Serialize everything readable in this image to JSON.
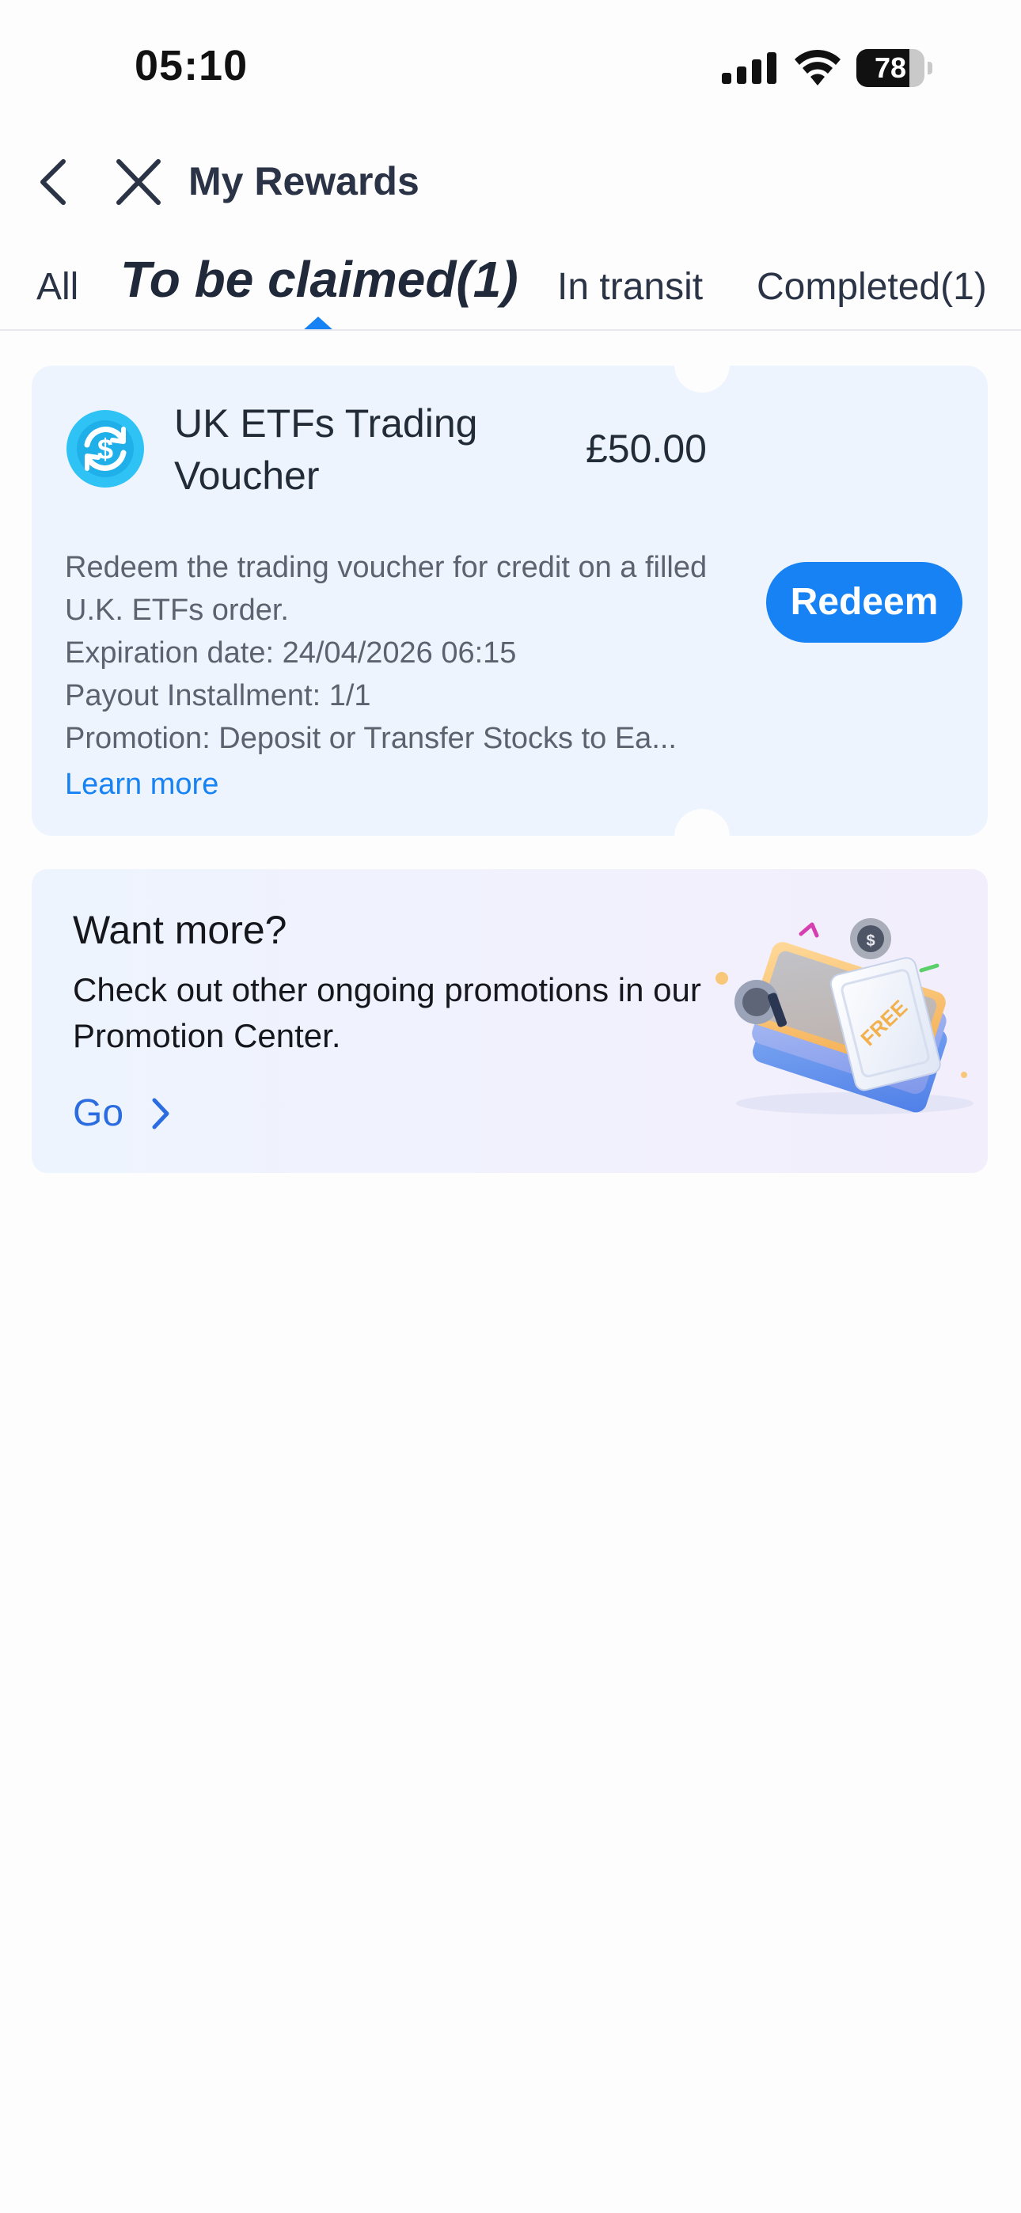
{
  "status_bar": {
    "time": "05:10",
    "battery": "78",
    "battery_level": 0.78
  },
  "header": {
    "title": "My Rewards"
  },
  "tabs": [
    {
      "label": "All"
    },
    {
      "label": "To be claimed(1)",
      "active": true
    },
    {
      "label": "In transit"
    },
    {
      "label": "Completed(1)"
    }
  ],
  "voucher": {
    "title": "UK ETFs Trading Voucher",
    "amount": "£50.00",
    "description": "Redeem the trading voucher for credit on a filled U.K. ETFs order.",
    "expiration": "Expiration date: 24/04/2026 06:15",
    "payout": "Payout Installment: 1/1",
    "promotion": "Promotion: Deposit or Transfer Stocks to Ea...",
    "learn_more": "Learn more",
    "redeem_label": "Redeem",
    "icon": "currency-exchange-icon"
  },
  "promo": {
    "title": "Want more?",
    "text": "Check out other ongoing promotions in our Promotion Center.",
    "go_label": "Go",
    "art_label": "FREE"
  },
  "colors": {
    "accent": "#1682f3",
    "voucher_bg": "#eef4fd",
    "text_primary": "#222b38",
    "text_secondary": "#5c6370",
    "link": "#2b6de0"
  }
}
